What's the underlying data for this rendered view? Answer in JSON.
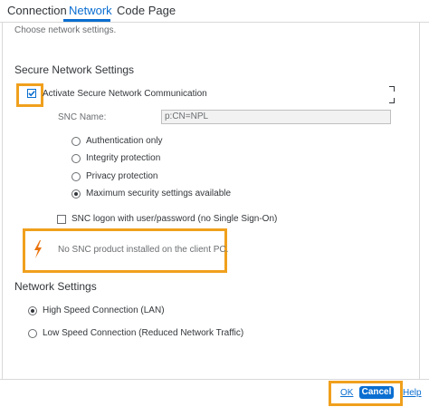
{
  "tabs": [
    {
      "label": "Connection"
    },
    {
      "label": "Network"
    },
    {
      "label": "Code Page"
    }
  ],
  "intro": "Choose network settings.",
  "secure": {
    "title": "Secure Network Settings",
    "activate_label": "Activate Secure Network Communication",
    "snc_name_label": "SNC Name:",
    "snc_name_value": "p:CN=NPL",
    "options": [
      "Authentication only",
      "Integrity protection",
      "Privacy protection",
      "Maximum security settings available"
    ],
    "logon_label": "SNC logon with user/password (no Single Sign-On)",
    "warning": "No SNC product installed on the client PC."
  },
  "network": {
    "title": "Network Settings",
    "options": [
      "High Speed Connection (LAN)",
      "Low Speed Connection (Reduced Network Traffic)"
    ]
  },
  "footer": {
    "ok": "OK",
    "cancel": "Cancel",
    "help": "Help"
  },
  "colors": {
    "accent": "#0a6ed1",
    "highlight": "#f0a01d",
    "warning_icon": "#e9730c"
  }
}
